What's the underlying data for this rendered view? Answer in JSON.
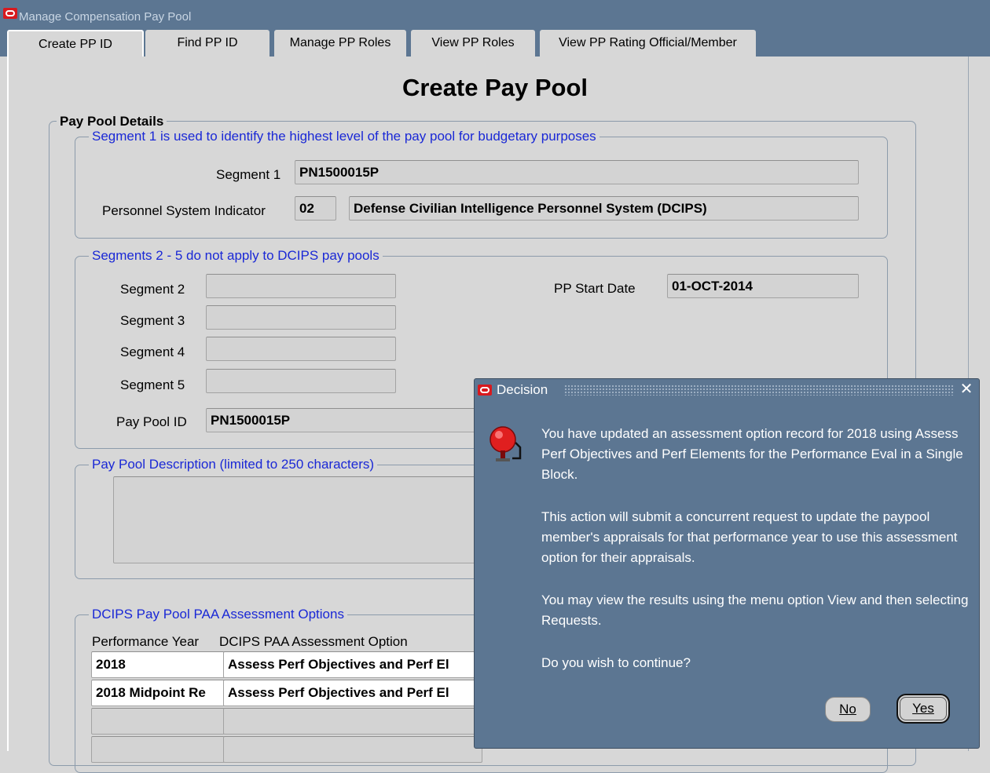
{
  "window": {
    "title": "Manage Compensation Pay Pool"
  },
  "tabs": [
    {
      "label": "Create PP ID"
    },
    {
      "label": "Find PP ID"
    },
    {
      "label": "Manage PP Roles"
    },
    {
      "label": "View PP Roles"
    },
    {
      "label": "View PP Rating Official/Member"
    }
  ],
  "page": {
    "title": "Create Pay Pool"
  },
  "details": {
    "legend": "Pay Pool Details",
    "segment1_group": {
      "legend": "Segment 1 is used to identify the highest level of the pay pool for budgetary purposes",
      "segment1_label": "Segment 1",
      "segment1_value": "PN1500015P",
      "psi_label": "Personnel System Indicator",
      "psi_code": "02",
      "psi_desc": "Defense Civilian Intelligence Personnel System (DCIPS)"
    },
    "segments_group": {
      "legend": "Segments 2 - 5 do not apply to DCIPS pay pools",
      "segment2_label": "Segment 2",
      "segment3_label": "Segment 3",
      "segment4_label": "Segment 4",
      "segment5_label": "Segment 5",
      "start_date_label": "PP Start Date",
      "start_date_value": "01-OCT-2014",
      "pay_pool_id_label": "Pay Pool ID",
      "pay_pool_id_value": "PN1500015P"
    },
    "description_group": {
      "legend": "Pay Pool Description (limited to 250 characters)",
      "value": ""
    },
    "assessment_group": {
      "legend": "DCIPS Pay Pool PAA Assessment Options",
      "col_year": "Performance Year",
      "col_option": "DCIPS PAA Assessment Option",
      "rows": [
        {
          "year": "2018",
          "option": "Assess Perf Objectives and Perf El"
        },
        {
          "year": "2018 Midpoint Re",
          "option": "Assess Perf Objectives and Perf El"
        },
        {
          "year": "",
          "option": ""
        },
        {
          "year": "",
          "option": ""
        }
      ]
    }
  },
  "dialog": {
    "title": "Decision",
    "close_glyph": "✕",
    "icon": "bell-alarm-icon",
    "paragraphs": [
      "You have updated an assessment option record for 2018 using Assess Perf Objectives and Perf Elements for the Performance Eval in a Single Block.",
      "This action will submit a concurrent request to update the paypool member's appraisals for that performance year to use this assessment option for their appraisals.",
      "You may view the results using the menu option View and then selecting Requests.",
      "Do you wish to continue?"
    ],
    "no_label": "No",
    "yes_label": "Yes"
  },
  "colors": {
    "title_bar": "#5c7692",
    "legend_blue": "#1a28d6",
    "oracle_red": "#d8191e"
  }
}
